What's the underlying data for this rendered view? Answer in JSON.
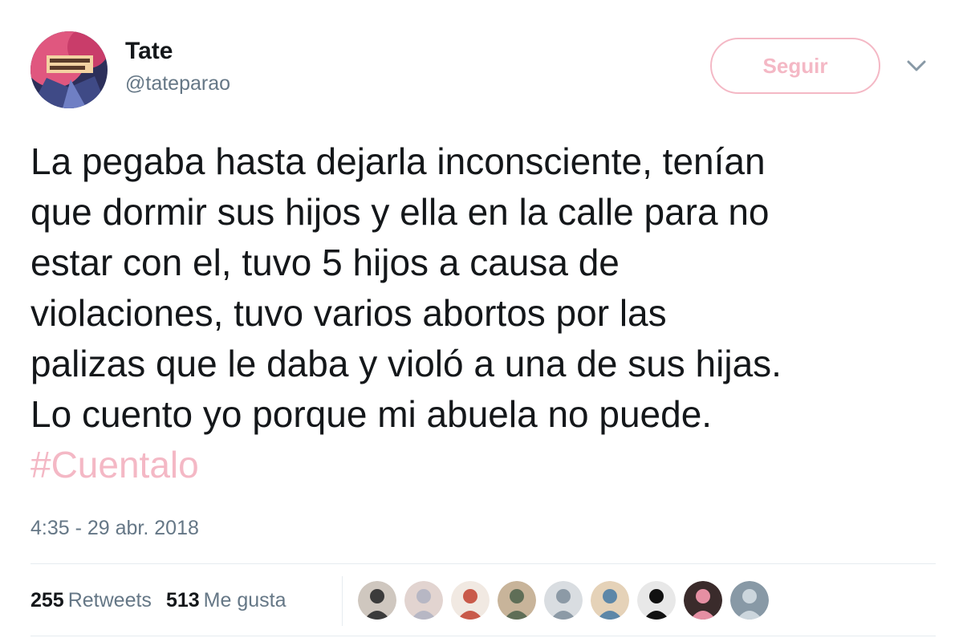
{
  "user": {
    "display_name": "Tate",
    "handle": "@tateparao",
    "avatar_icon": "profile-photo"
  },
  "follow_button": {
    "label": "Seguir"
  },
  "menu": {
    "icon": "chevron-down-icon"
  },
  "tweet": {
    "lines": [
      "La pegaba hasta dejarla inconsciente, tenían",
      "que dormir sus hijos y ella en la calle para no",
      "estar con el, tuvo 5 hijos a causa de",
      "violaciones, tuvo varios abortos por las",
      "palizas que le daba y violó a una de sus hijas.",
      "Lo cuento yo porque mi abuela no puede."
    ],
    "hashtag": "#Cuentalo",
    "timestamp": "4:35 - 29 abr. 2018"
  },
  "stats": {
    "retweets_count": "255",
    "retweets_label": "Retweets",
    "likes_count": "513",
    "likes_label": "Me gusta"
  },
  "likers": [
    {
      "name": "liker-avatar-1",
      "colors": [
        "#3b3b3b",
        "#cfc7bf"
      ]
    },
    {
      "name": "liker-avatar-2",
      "colors": [
        "#b7b7c4",
        "#e2d4d0"
      ]
    },
    {
      "name": "liker-avatar-3",
      "colors": [
        "#c95a4a",
        "#f1e9e2"
      ]
    },
    {
      "name": "liker-avatar-4",
      "colors": [
        "#5f6e57",
        "#c8b49a"
      ]
    },
    {
      "name": "liker-avatar-5",
      "colors": [
        "#8c9aa6",
        "#d9dde1"
      ]
    },
    {
      "name": "liker-avatar-6",
      "colors": [
        "#5d87a8",
        "#e5d2b8"
      ]
    },
    {
      "name": "liker-avatar-7",
      "colors": [
        "#111111",
        "#e8e8e8"
      ]
    },
    {
      "name": "liker-avatar-8",
      "colors": [
        "#e58fa3",
        "#3a2b2b"
      ]
    },
    {
      "name": "liker-avatar-9",
      "colors": [
        "#ccd6dd",
        "#8899a6"
      ]
    }
  ],
  "colors": {
    "accent_pink": "#f4b8c5",
    "text_primary": "#14171a",
    "text_secondary": "#657786",
    "divider": "#e6ecf0"
  }
}
